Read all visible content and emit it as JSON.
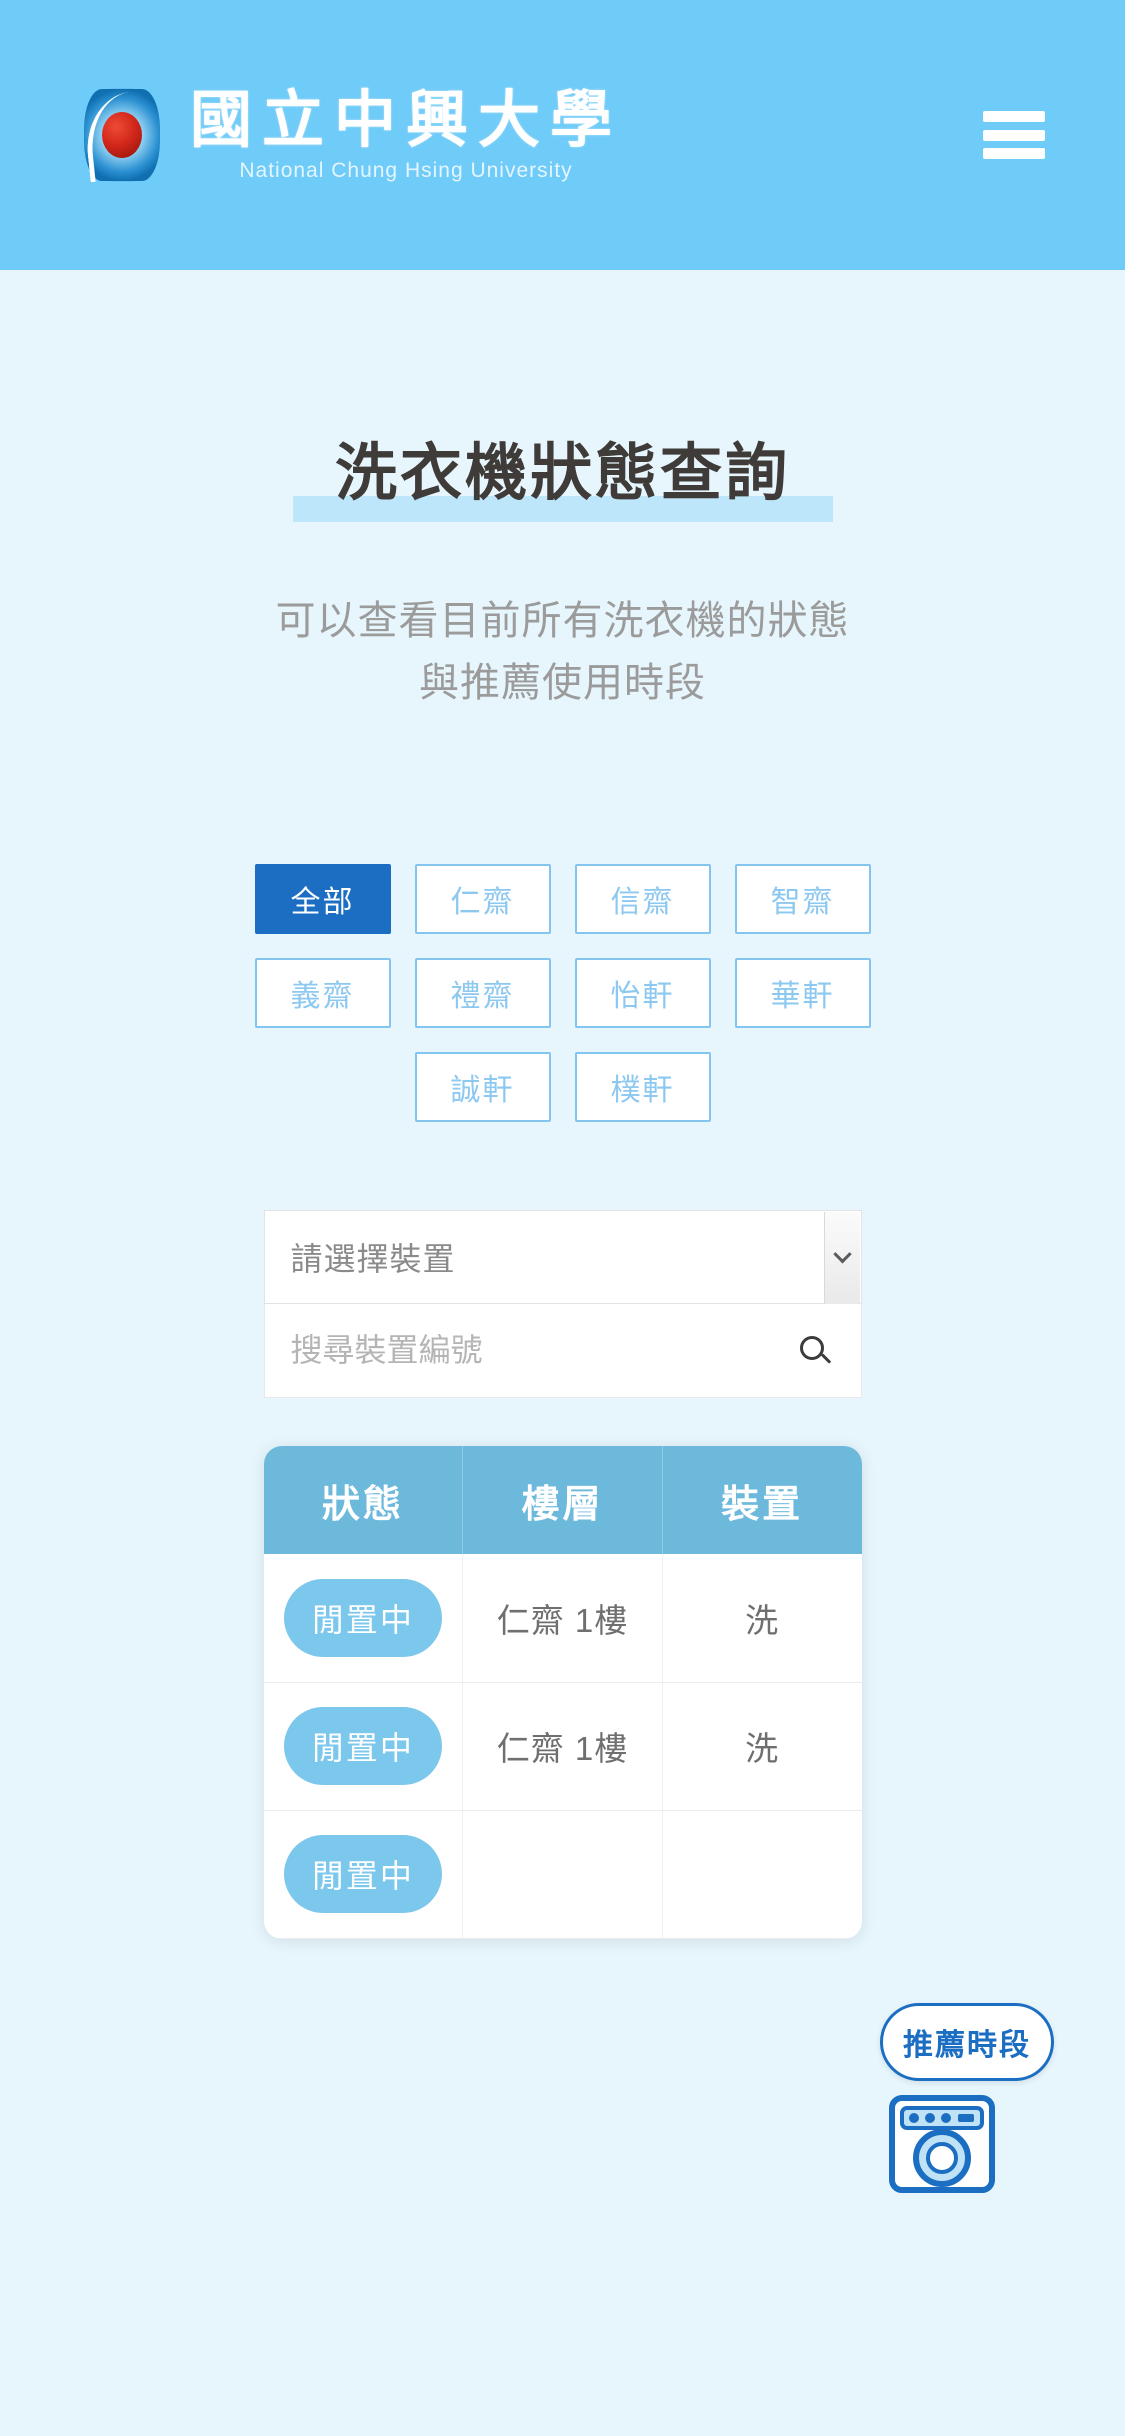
{
  "header": {
    "logo_icon": "nchu-logo-icon",
    "brand_cn": "國立中興大學",
    "brand_en": "National Chung Hsing University",
    "menu_icon": "hamburger-menu-icon",
    "background_color": "#6fcbf8"
  },
  "page": {
    "title": "洗衣機狀態查詢",
    "subtitle": "可以查看目前所有洗衣機的狀態與推薦使用時段",
    "background_color": "#e7f6fd",
    "accent_color": "#1b6ec2",
    "title_highlight_color": "#bee6fa"
  },
  "filters": {
    "items": [
      {
        "label": "全部",
        "active": true
      },
      {
        "label": "仁齋",
        "active": false
      },
      {
        "label": "信齋",
        "active": false
      },
      {
        "label": "智齋",
        "active": false
      },
      {
        "label": "義齋",
        "active": false
      },
      {
        "label": "禮齋",
        "active": false
      },
      {
        "label": "怡軒",
        "active": false
      },
      {
        "label": "華軒",
        "active": false
      },
      {
        "label": "誠軒",
        "active": false
      },
      {
        "label": "樸軒",
        "active": false
      }
    ]
  },
  "device_select": {
    "value": "請選擇裝置",
    "arrow_icon": "chevron-down-icon"
  },
  "search": {
    "value": "",
    "placeholder": "搜尋裝置編號",
    "icon": "search-icon"
  },
  "table": {
    "columns": [
      "狀態",
      "樓層",
      "裝置"
    ],
    "rows": [
      {
        "status": "閒置中",
        "floor": "仁齋 1樓",
        "device": "洗"
      },
      {
        "status": "閒置中",
        "floor": "仁齋 1樓",
        "device": "洗"
      },
      {
        "status": "閒置中",
        "floor": "",
        "device": ""
      }
    ],
    "header_color": "#6cb9dc",
    "status_pill_color": "#7cc7ec"
  },
  "floating": {
    "recommend_label": "推薦時段",
    "washer_icon": "washing-machine-icon"
  }
}
